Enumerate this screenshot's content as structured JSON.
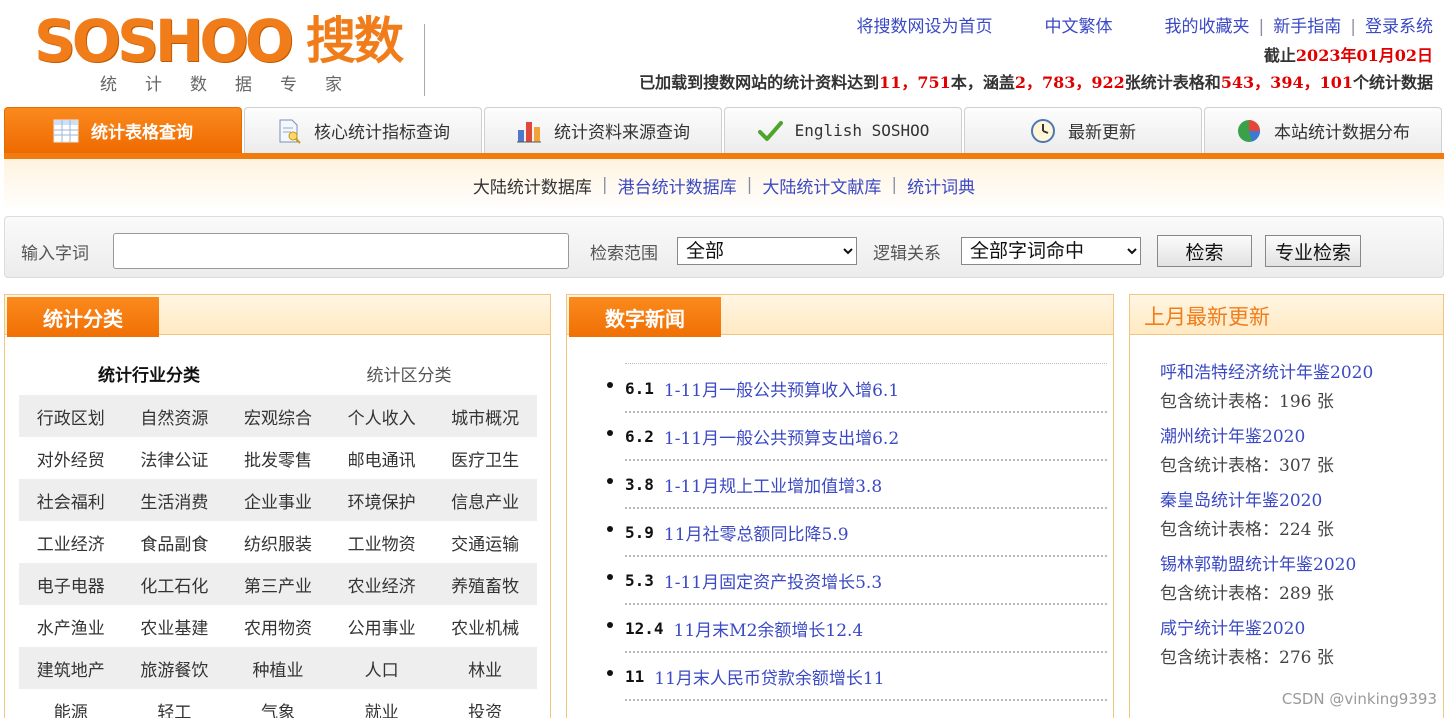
{
  "logo": {
    "main": "SOSHOO",
    "cn": "搜数",
    "sub": "统计数据专家"
  },
  "toplinks": {
    "set_home": "将搜数网设为首页",
    "traditional": "中文繁体",
    "favorites": "我的收藏夹",
    "guide": "新手指南",
    "login": "登录系统"
  },
  "dateline": {
    "prefix": "截止",
    "date": "2023年01月02日"
  },
  "stats": {
    "p1": "已加载到搜数网站的统计资料达到",
    "books": "11，751",
    "p2": "本，涵盖",
    "tables": "2，783，922",
    "p3": "张统计表格和",
    "data": "543，394，101",
    "p4": "个统计数据"
  },
  "tabs": [
    {
      "label": "统计表格查询",
      "icon": "table-icon",
      "active": true
    },
    {
      "label": "核心统计指标查询",
      "icon": "document-search-icon"
    },
    {
      "label": "统计资料来源查询",
      "icon": "bar-chart-icon"
    },
    {
      "label": "English SOSHOO",
      "icon": "checkmark-icon"
    },
    {
      "label": "最新更新",
      "icon": "clock-icon"
    },
    {
      "label": "本站统计数据分布",
      "icon": "pie-chart-icon"
    }
  ],
  "subnav": [
    "大陆统计数据库",
    "港台统计数据库",
    "大陆统计文献库",
    "统计词典"
  ],
  "search": {
    "word_label": "输入字词",
    "word_value": "",
    "range_label": "检索范围",
    "range_value": "全部",
    "logic_label": "逻辑关系",
    "logic_value": "全部字词命中",
    "search_btn": "检索",
    "pro_btn": "专业检索"
  },
  "categories": {
    "title": "统计分类",
    "tab_industry": "统计行业分类",
    "tab_region": "统计区分类",
    "rows": [
      [
        "行政区划",
        "自然资源",
        "宏观综合",
        "个人收入",
        "城市概况"
      ],
      [
        "对外经贸",
        "法律公证",
        "批发零售",
        "邮电通讯",
        "医疗卫生"
      ],
      [
        "社会福利",
        "生活消费",
        "企业事业",
        "环境保护",
        "信息产业"
      ],
      [
        "工业经济",
        "食品副食",
        "纺织服装",
        "工业物资",
        "交通运输"
      ],
      [
        "电子电器",
        "化工石化",
        "第三产业",
        "农业经济",
        "养殖畜牧"
      ],
      [
        "水产渔业",
        "农业基建",
        "农用物资",
        "公用事业",
        "农业机械"
      ],
      [
        "建筑地产",
        "旅游餐饮",
        "种植业",
        "人口",
        "林业"
      ],
      [
        "能源",
        "轻工",
        "气象",
        "就业",
        "投资"
      ]
    ]
  },
  "news": {
    "title": "数字新闻",
    "items": [
      {
        "value": "6.1",
        "title": "1-11月一般公共预算收入增6.1"
      },
      {
        "value": "6.2",
        "title": "1-11月一般公共预算支出增6.2"
      },
      {
        "value": "3.8",
        "title": "1-11月规上工业增加值增3.8"
      },
      {
        "value": "5.9",
        "title": "11月社零总额同比降5.9"
      },
      {
        "value": "5.3",
        "title": "1-11月固定资产投资增长5.3"
      },
      {
        "value": "12.4",
        "title": "11月末M2余额增长12.4"
      },
      {
        "value": "11",
        "title": "11月末人民币贷款余额增长11"
      }
    ]
  },
  "updates": {
    "title": "上月最新更新",
    "count_prefix": "包含统计表格：",
    "items": [
      {
        "title": "呼和浩特经济统计年鉴2020",
        "count": "196 张"
      },
      {
        "title": "潮州统计年鉴2020",
        "count": "307 张"
      },
      {
        "title": "秦皇岛统计年鉴2020",
        "count": "224 张"
      },
      {
        "title": "锡林郭勒盟统计年鉴2020",
        "count": "289 张"
      },
      {
        "title": "咸宁统计年鉴2020",
        "count": "276 张"
      }
    ]
  },
  "watermark": "CSDN @vinking9393",
  "colors": {
    "accent": "#f27b0f",
    "link": "#3b49c4",
    "highlight": "#e00000"
  }
}
